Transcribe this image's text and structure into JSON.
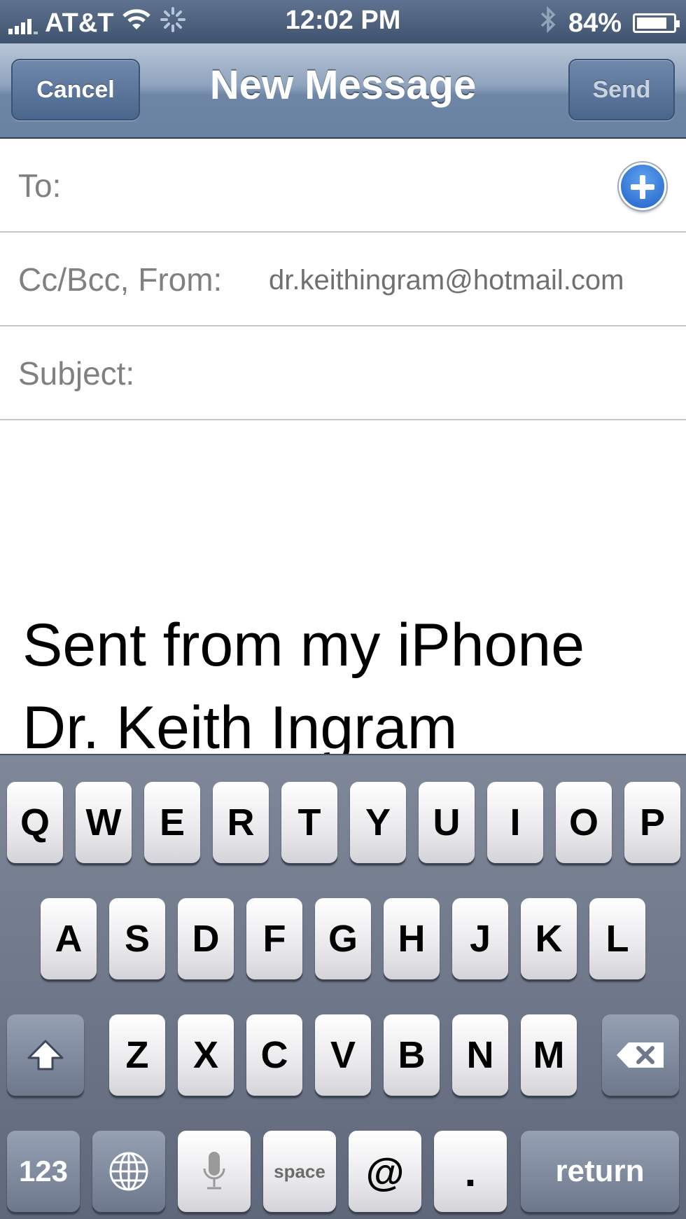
{
  "status_bar": {
    "carrier": "AT&T",
    "time": "12:02 PM",
    "battery_percent": "84%",
    "battery_level": 0.84
  },
  "nav": {
    "cancel_label": "Cancel",
    "title": "New Message",
    "send_label": "Send"
  },
  "fields": {
    "to_label": "To:",
    "ccbcc_label": "Cc/Bcc, From:",
    "from_value": "dr.keithingram@hotmail.com",
    "subject_label": "Subject:"
  },
  "body": {
    "line1": "Sent from my iPhone",
    "line2": "Dr. Keith Ingram"
  },
  "keyboard": {
    "row1": [
      "Q",
      "W",
      "E",
      "R",
      "T",
      "Y",
      "U",
      "I",
      "O",
      "P"
    ],
    "row2": [
      "A",
      "S",
      "D",
      "F",
      "G",
      "H",
      "J",
      "K",
      "L"
    ],
    "row3": [
      "Z",
      "X",
      "C",
      "V",
      "B",
      "N",
      "M"
    ],
    "numbers_label": "123",
    "space_label": "space",
    "at_label": "@",
    "dot_label": ".",
    "return_label": "return"
  }
}
